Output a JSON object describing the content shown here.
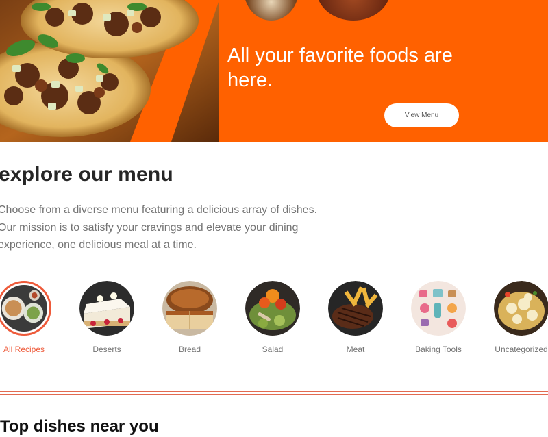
{
  "hero": {
    "heading": "All your favorite foods are here.",
    "button_label": "View Menu",
    "background_color": "#ff6100"
  },
  "explore": {
    "title": "explore our menu",
    "description": "Choose from a diverse menu featuring a delicious array of dishes. Our mission is to satisfy your cravings and elevate your dining experience, one delicious meal at a time."
  },
  "categories": [
    {
      "label": "All Recipes",
      "active": true
    },
    {
      "label": "Deserts",
      "active": false
    },
    {
      "label": "Bread",
      "active": false
    },
    {
      "label": "Salad",
      "active": false
    },
    {
      "label": "Meat",
      "active": false
    },
    {
      "label": "Baking Tools",
      "active": false
    },
    {
      "label": "Uncategorized",
      "active": false
    }
  ],
  "accent_color": "#ee5a3a",
  "top_dishes": {
    "title": "Top dishes near you"
  }
}
